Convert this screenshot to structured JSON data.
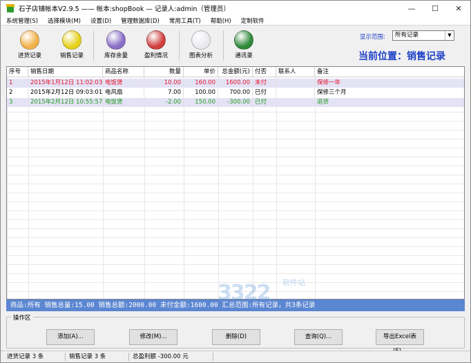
{
  "window": {
    "title": "石子店铺帐本V2.9.5  ——  帐本:shopBook — 记录人:admin（管理员）",
    "minimize": "—",
    "maximize": "☐",
    "close": "✕"
  },
  "menu": [
    "系统管理(S)",
    "选择模块(M)",
    "设置(D)",
    "管理数据库(D)",
    "常用工具(T)",
    "帮助(H)",
    "定制软件"
  ],
  "toolbar": {
    "tools": [
      {
        "label": "进货记录",
        "icon": "cube-icon",
        "color": "#f2b24a"
      },
      {
        "label": "销售记录",
        "icon": "yen-coin-icon",
        "color": "#e6d21c"
      },
      {
        "label": "库存余量",
        "icon": "warehouse-icon",
        "color": "#8a6fc8"
      },
      {
        "label": "盈利情况",
        "icon": "coins-icon",
        "color": "#d04040"
      },
      {
        "label": "图表分析",
        "icon": "bar-chart-icon",
        "color": "#e9e9f2"
      },
      {
        "label": "通讯录",
        "icon": "phone-icon",
        "color": "#2f8a3a"
      }
    ],
    "range_label": "显示范围:",
    "range_value": "所有记录",
    "location": "当前位置：销售记录"
  },
  "table": {
    "columns": [
      "序号",
      "销售日期",
      "商品名称",
      "数量",
      "单价",
      "总金额(元)",
      "付否",
      "联系人",
      "备注"
    ],
    "rows": [
      {
        "no": "1",
        "date": "2015年1月12日 11:02:03",
        "product": "电饭煲",
        "qty": "10.00",
        "price": "160.00",
        "total": "1600.00",
        "paid": "未付",
        "contact": "",
        "note": "保修一年",
        "color": "#e0142a",
        "bg": "#e4e2f5"
      },
      {
        "no": "2",
        "date": "2015年2月12日 09:03:01",
        "product": "电风扇",
        "qty": "7.00",
        "price": "100.00",
        "total": "700.00",
        "paid": "已付",
        "contact": "",
        "note": "保修三个月",
        "color": "#000000",
        "bg": "#ffffff"
      },
      {
        "no": "3",
        "date": "2015年2月12日 10:55:57",
        "product": "电饭煲",
        "qty": "-2.00",
        "price": "150.00",
        "total": "-300.00",
        "paid": "已付",
        "contact": "",
        "note": "退货",
        "color": "#1f9a1f",
        "bg": "#e4e2f5"
      }
    ]
  },
  "summary": "商品:所有  销售总量:15.00  销售总额:2000.00  未付金额:1600.00  汇总范围:所有记录，共3条记录",
  "ops": {
    "title": "操作区",
    "buttons": [
      "添加(A)...",
      "修改(M)...",
      "删除(D)",
      "查询(Q)...",
      "导出Excel表(E)..."
    ]
  },
  "status": [
    "进货记录 3 条",
    "销售记录 3 条",
    "总盈利额 -300.00 元"
  ],
  "watermark": {
    "num": "3322",
    "text": "软件站"
  }
}
